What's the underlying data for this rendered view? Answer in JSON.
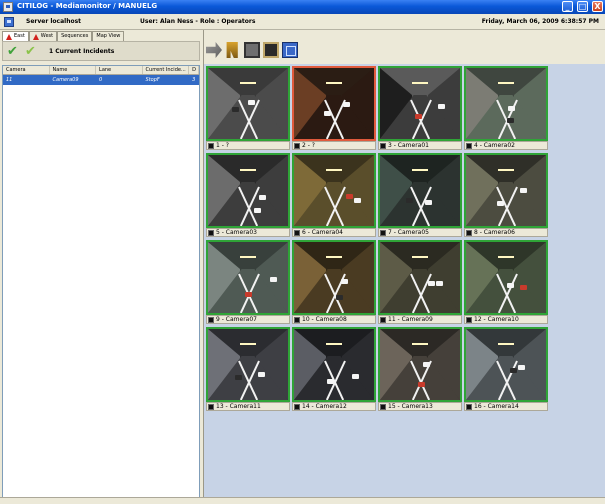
{
  "window": {
    "title": "CITILOG - Mediamonitor / MANUELG",
    "buttons": [
      "_",
      "□",
      "X"
    ]
  },
  "header": {
    "server": "Server localhost",
    "user": "User: Alan Ness - Role : Operators",
    "datetime": "Friday, March 06, 2009 6:38:57 PM"
  },
  "tabs": [
    {
      "label": "East",
      "warning": true
    },
    {
      "label": "West",
      "warning": true
    },
    {
      "label": "Sequences",
      "warning": false
    },
    {
      "label": "Map View",
      "warning": false
    }
  ],
  "incidents": {
    "label": "1 Current Incidents",
    "icons": [
      "check-icon",
      "double-check-icon"
    ]
  },
  "table": {
    "columns": [
      "Camera",
      "Name",
      "Lane",
      "Current Incide...",
      "D"
    ],
    "rows": [
      {
        "camera": "11",
        "name": "Camera09",
        "lane": "0",
        "incident": "StopF",
        "d": "3"
      }
    ]
  },
  "toolbar": {
    "icons": [
      "route-icon",
      "tools-icon",
      "camera-settings-icon",
      "film-icon",
      "layout-grid-icon"
    ]
  },
  "cameras": [
    {
      "label": "1 - ?",
      "alert": false
    },
    {
      "label": "2 - ?",
      "alert": true
    },
    {
      "label": "3 - Camera01",
      "alert": false
    },
    {
      "label": "4 - Camera02",
      "alert": false
    },
    {
      "label": "5 - Camera03",
      "alert": false
    },
    {
      "label": "6 - Camera04",
      "alert": false
    },
    {
      "label": "7 - Camera05",
      "alert": false
    },
    {
      "label": "8 - Camera06",
      "alert": false
    },
    {
      "label": "9 - Camera07",
      "alert": false
    },
    {
      "label": "10 - Camera08",
      "alert": false
    },
    {
      "label": "11 - Camera09",
      "alert": false
    },
    {
      "label": "12 - Camera10",
      "alert": false
    },
    {
      "label": "13 - Camera11",
      "alert": false
    },
    {
      "label": "14 - Camera12",
      "alert": false
    },
    {
      "label": "15 - Camera13",
      "alert": false
    },
    {
      "label": "16 - Camera14",
      "alert": false
    }
  ],
  "colors": {
    "title_bar": "#0a58d8",
    "selected_row": "#316ac5",
    "camera_border": "#2fa437",
    "alert_border": "#e05a3c",
    "monitor_background": "#c7d3e6"
  }
}
